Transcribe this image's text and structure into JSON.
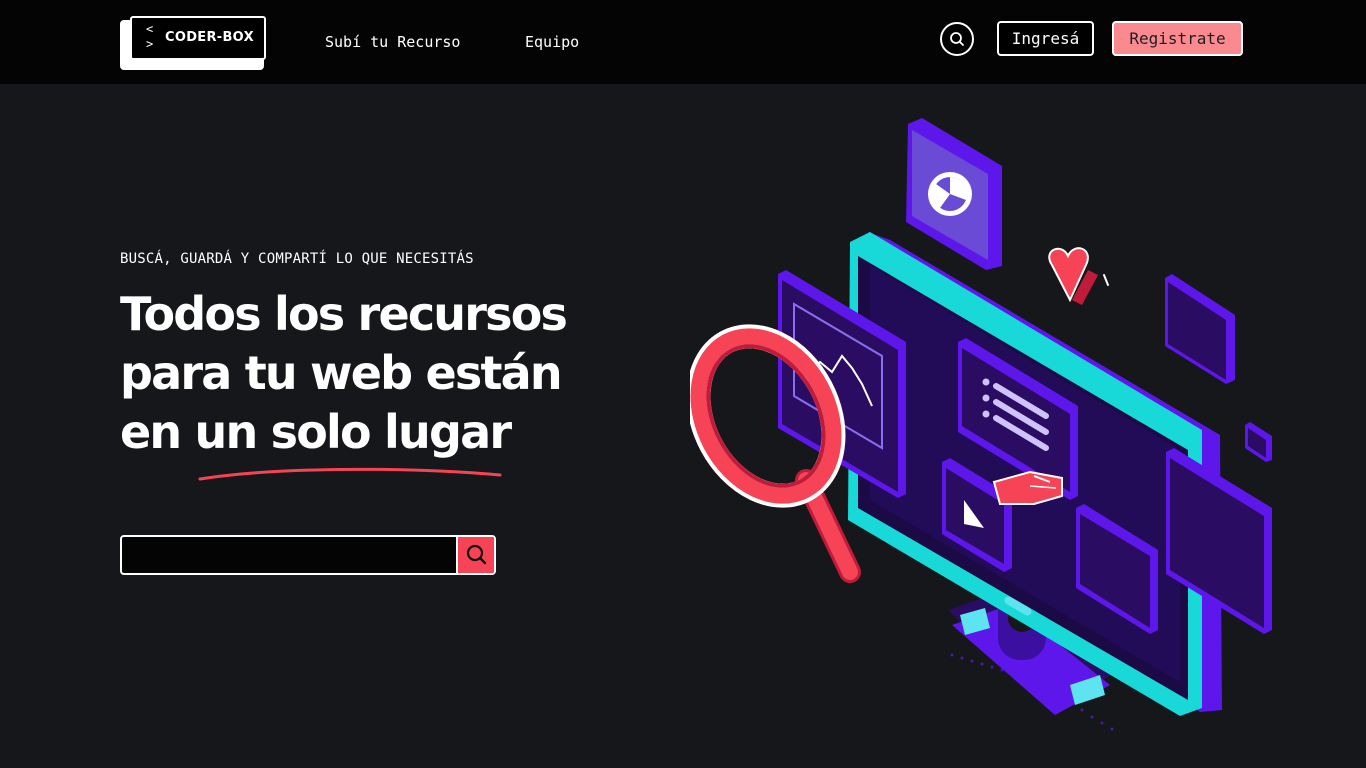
{
  "brand": {
    "name": "CODER-BOX",
    "chevrons": "<\n>"
  },
  "nav": {
    "upload": "Subí tu Recurso",
    "team": "Equipo"
  },
  "auth": {
    "login": "Ingresá",
    "register": "Registrate"
  },
  "hero": {
    "eyebrow": "BUSCÁ, GUARDÁ Y COMPARTÍ LO QUE NECESITÁS",
    "headline_lines": [
      "Todos los recursos",
      "para tu web están",
      "en un solo lugar"
    ]
  },
  "search": {
    "placeholder": "",
    "value": ""
  },
  "icons": {
    "nav_search": "search-icon",
    "submit": "search-icon",
    "illustration": "isometric-monitor-illustration"
  },
  "colors": {
    "background": "#16171a",
    "navbar": "#040404",
    "accent": "#f64355",
    "register": "#fb8a90",
    "purple": "#5e17eb",
    "cyan": "#19d8d8"
  }
}
